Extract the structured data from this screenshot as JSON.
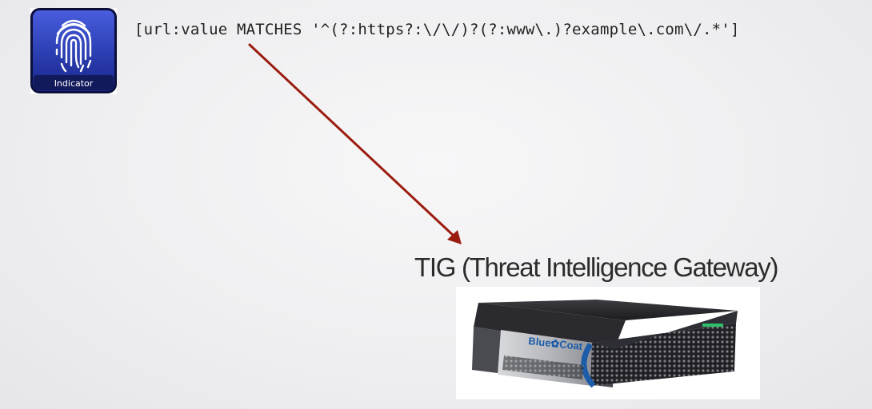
{
  "indicator": {
    "label": "Indicator",
    "icon": "fingerprint-icon",
    "colors": {
      "tile": "#2a3db0",
      "tile_border": "#0b0f3a",
      "label_bar": "#121a5c"
    }
  },
  "pattern": {
    "text": "[url:value MATCHES '^(?:https?:\\/\\/)?(?:www\\.)?example\\.com\\/.*']"
  },
  "arrow": {
    "color": "#9b1c0f"
  },
  "gateway": {
    "title": "TIG (Threat Intelligence Gateway)",
    "device_icon": "network-appliance-icon",
    "brand_logo": "Blue Coat",
    "colors": {
      "accent": "#1c5ca8"
    }
  }
}
